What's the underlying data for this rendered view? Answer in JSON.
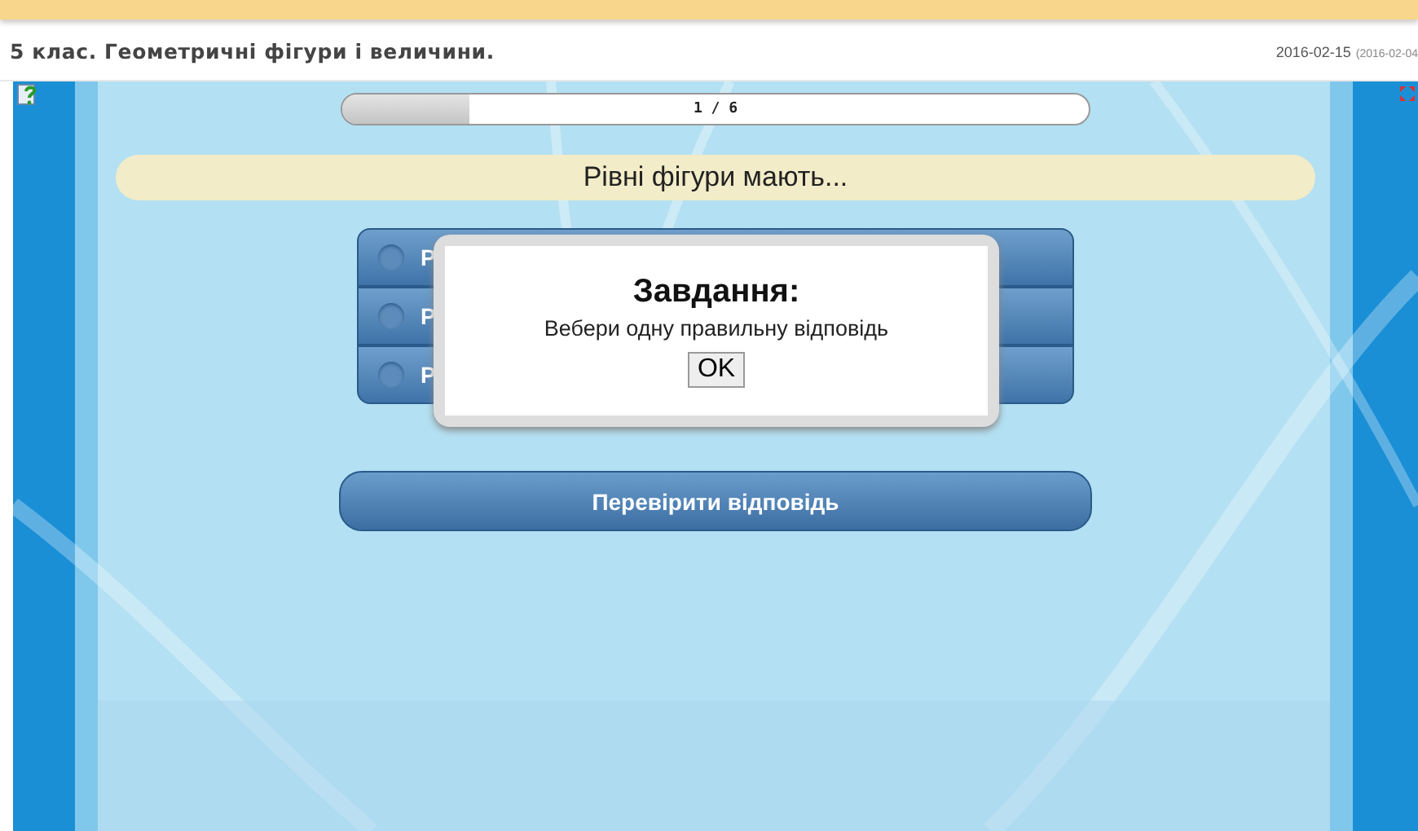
{
  "page_title": "5 клас. Геометричні фігури і величини.",
  "date": "2016-02-15",
  "date_note": "(2016-02-04",
  "progress": {
    "level": 0.17,
    "label": "1 / 6"
  },
  "question": "Рівні фігури мають...",
  "options": [
    {
      "label": "Р",
      "selected": false
    },
    {
      "label": "Р",
      "selected": false
    },
    {
      "label": "Р",
      "selected": false
    }
  ],
  "check_button": "Перевірити відповідь",
  "dialog": {
    "title": "Завдання:",
    "message": "Вебери одну правильну відповідь",
    "button": "OK"
  }
}
